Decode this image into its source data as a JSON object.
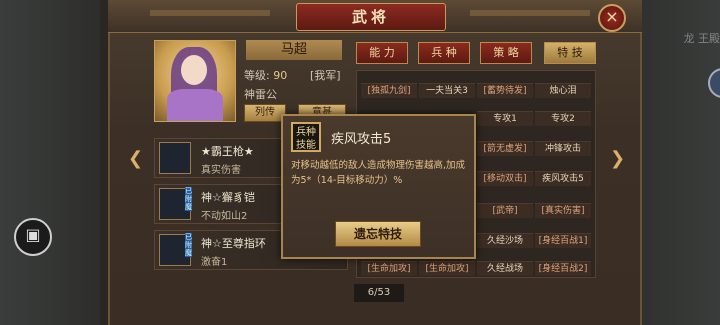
{
  "window": {
    "title": "武将",
    "close_icon": "×"
  },
  "background": {
    "top_right_text": "龙 王殿"
  },
  "hero": {
    "name": "马超",
    "level_label": "等级:",
    "level_value": "90",
    "faction": "[我军]",
    "title": "神雷公",
    "bio_button": "列传",
    "second_button": "意甚"
  },
  "tabs": [
    {
      "label": "能 力"
    },
    {
      "label": "兵 种"
    },
    {
      "label": "策 略"
    },
    {
      "label": "特 技"
    }
  ],
  "skills": [
    [
      "[独孤九剑]",
      "一夫当关3",
      "[蓄势待发]",
      "烛心泪"
    ],
    [
      "专攻1",
      "专攻2"
    ],
    [
      "[箭无虚发]",
      "冲锋攻击"
    ],
    [
      "[移动双击]",
      "疾风攻击5"
    ],
    [
      "[武帝]",
      "[真实伤害]"
    ],
    [
      "久经沙场",
      "[身经百战1]"
    ],
    [
      "[生命加攻]",
      "[生命加攻]",
      "久经战场",
      "[身经百战2]"
    ]
  ],
  "equipment": [
    {
      "name": "★霸王枪★",
      "sub": "真实伤害",
      "tag": ""
    },
    {
      "name": "神☆獬豸铠",
      "sub": "不动如山2",
      "tag": "已附魔"
    },
    {
      "name": "神☆至尊指环",
      "sub": "激奋1",
      "tag": "已附魔"
    }
  ],
  "modal": {
    "badge": "兵种技能",
    "title": "疾风攻击5",
    "description": "对移动越低的敌人造成物理伤害越高,加成为5*（14-目标移动力）%",
    "button": "遗忘特技"
  },
  "pager": {
    "text": "6/53"
  }
}
